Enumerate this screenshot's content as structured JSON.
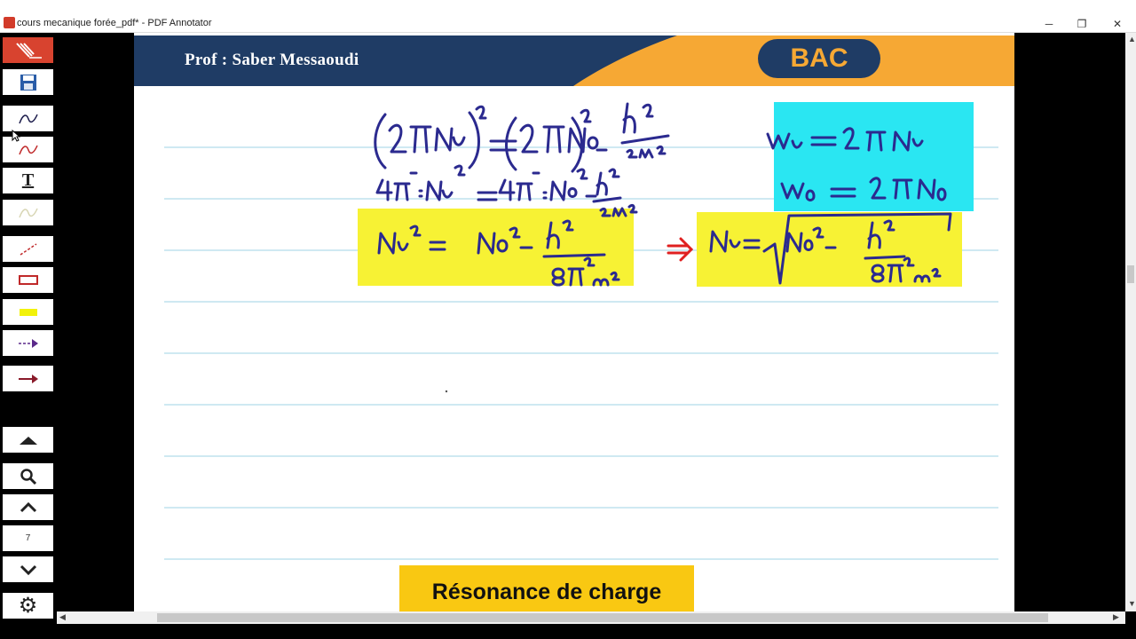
{
  "window": {
    "title": "cours mecanique forée_pdf* - PDF Annotator",
    "controls": {
      "minimize": "─",
      "restore": "❐",
      "close": "✕"
    }
  },
  "toolbar": {
    "tools": [
      {
        "name": "app-logo",
        "glyph": "✒"
      },
      {
        "name": "save",
        "glyph": "💾"
      },
      {
        "name": "pen-dark",
        "glyph": "∿"
      },
      {
        "name": "pen-red",
        "glyph": "∿"
      },
      {
        "name": "text",
        "glyph": "T"
      },
      {
        "name": "pen-light",
        "glyph": "∿"
      },
      {
        "name": "line",
        "glyph": "╱"
      },
      {
        "name": "rectangle",
        "glyph": "▭"
      },
      {
        "name": "highlighter",
        "glyph": "▬"
      },
      {
        "name": "dashed-arrow",
        "glyph": "⇢"
      },
      {
        "name": "arrow",
        "glyph": "→"
      },
      {
        "name": "first-page",
        "glyph": "▲"
      },
      {
        "name": "zoom",
        "glyph": "🔍"
      },
      {
        "name": "previous-page",
        "glyph": "⌃"
      },
      {
        "name": "page-number",
        "glyph": "7"
      },
      {
        "name": "next-page",
        "glyph": "⌄"
      },
      {
        "name": "settings",
        "glyph": "⚙"
      }
    ]
  },
  "page": {
    "header_author": "Prof : Saber Messaoudi",
    "header_badge": "BAC",
    "section_title": "Résonance de charge"
  },
  "annotations": {
    "ink_color": "#2b2a8f",
    "arrow_color": "#e02020",
    "highlight_yellow": "#f7f234",
    "highlight_cyan": "#2ae6f2"
  }
}
